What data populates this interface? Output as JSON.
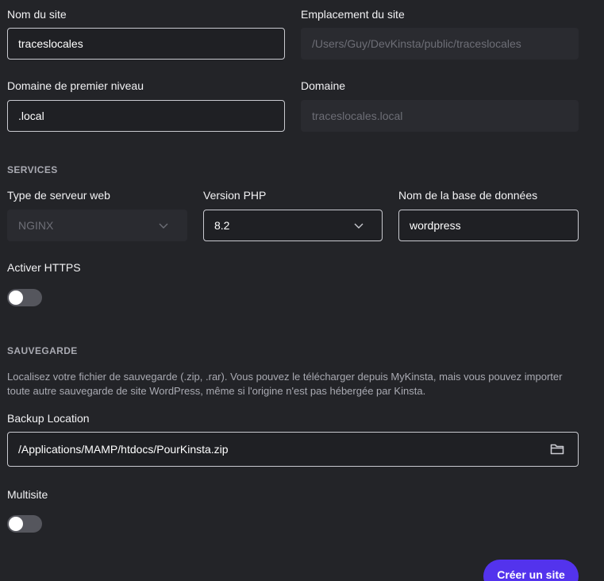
{
  "site": {
    "name_label": "Nom du site",
    "name_value": "traceslocales",
    "location_label": "Emplacement du site",
    "location_value": "/Users/Guy/DevKinsta/public/traceslocales",
    "tld_label": "Domaine de premier niveau",
    "tld_value": ".local",
    "domain_label": "Domaine",
    "domain_value": "traceslocales.local"
  },
  "services": {
    "title": "SERVICES",
    "webserver_label": "Type de serveur web",
    "webserver_value": "NGINX",
    "php_label": "Version PHP",
    "php_value": "8.2",
    "db_label": "Nom de la base de données",
    "db_value": "wordpress",
    "https_label": "Activer HTTPS"
  },
  "backup": {
    "title": "SAUVEGARDE",
    "description": "Localisez votre fichier de sauvegarde (.zip, .rar). Vous pouvez le télécharger depuis MyKinsta, mais vous pouvez importer toute autre sauvegarde de site WordPress, même si l'origine n'est pas hébergée par Kinsta.",
    "location_label": "Backup Location",
    "location_value": "/Applications/MAMP/htdocs/PourKinsta.zip",
    "multisite_label": "Multisite"
  },
  "actions": {
    "create_label": "Créer un site"
  },
  "toggles": {
    "https_on": false,
    "multisite_on": false
  },
  "icons": {
    "select": "chevron-down-icon",
    "browse": "folder-icon"
  },
  "colors": {
    "background": "#232428",
    "primary": "#5333ed",
    "field_border": "#c9cad0",
    "muted_text": "#a9aab2"
  }
}
